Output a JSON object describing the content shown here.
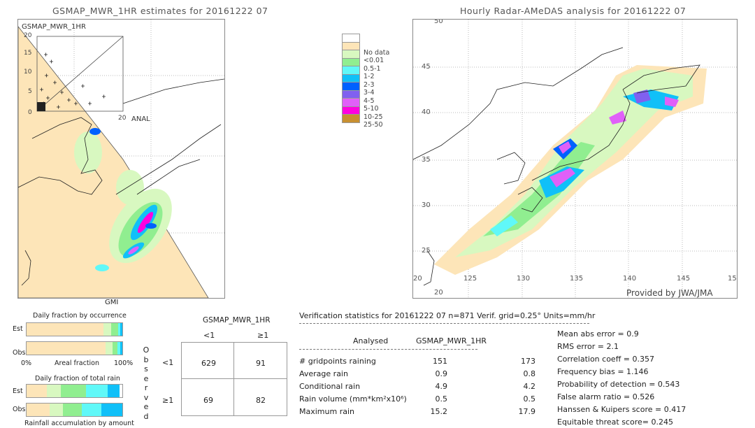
{
  "left_map": {
    "title": "GSMAP_MWR_1HR estimates for 20161222 07",
    "inset_label": "GSMAP_MWR_1HR",
    "inset_xlabel": "ANAL",
    "inset_ticks": [
      "0",
      "5",
      "10",
      "15",
      "20"
    ],
    "sensor_label": "GMI"
  },
  "right_map": {
    "title": "Hourly Radar-AMeDAS analysis for 20161222 07",
    "lon_ticks": [
      "125",
      "130",
      "135",
      "140",
      "145",
      "15"
    ],
    "lat_ticks": [
      "45",
      "40",
      "35",
      "30",
      "25",
      "20"
    ],
    "corner_labels": [
      "20",
      "20",
      "50"
    ],
    "credit": "Provided by JWA/JMA"
  },
  "legend": {
    "items": [
      {
        "label": "",
        "color": "#ffffff"
      },
      {
        "label": "No data",
        "color": "#fde5b8"
      },
      {
        "label": "<0.01",
        "color": "#d8f8c0"
      },
      {
        "label": "0.5-1",
        "color": "#90ee90"
      },
      {
        "label": "1-2",
        "color": "#60f8f8"
      },
      {
        "label": "2-3",
        "color": "#10c0f8"
      },
      {
        "label": "3-4",
        "color": "#0060ff"
      },
      {
        "label": "4-5",
        "color": "#8060f0"
      },
      {
        "label": "5-10",
        "color": "#e060f8"
      },
      {
        "label": "10-25",
        "color": "#ff00e0"
      },
      {
        "label": "25-50",
        "color": "#c89030"
      }
    ]
  },
  "occurrence": {
    "title": "Daily fraction by occurrence",
    "est_label": "Est",
    "obs_label": "Obs",
    "axis_left": "0%",
    "axis_mid": "Areal fraction",
    "axis_right": "100%",
    "est": [
      0.8,
      0.08,
      0.077,
      0.023,
      0.02
    ],
    "obs": [
      0.826,
      0.074,
      0.05,
      0.026,
      0.024
    ]
  },
  "total_rain": {
    "title": "Daily fraction of total rain",
    "est_label": "Est",
    "obs_label": "Obs",
    "footer": "Rainfall accumulation by amount",
    "est": [
      0.21,
      0.147,
      0.266,
      0.225,
      0.122
    ],
    "obs": [
      0.244,
      0.136,
      0.195,
      0.205,
      0.22
    ]
  },
  "bar_colors": [
    "#fde5b8",
    "#d8f8c0",
    "#90ee90",
    "#60f8f8",
    "#10c0f8"
  ],
  "contingency": {
    "header": "GSMAP_MWR_1HR",
    "col_labels": [
      "<1",
      "≥1"
    ],
    "row_labels": [
      "<1",
      "≥1"
    ],
    "side_label": [
      "O",
      "b",
      "s",
      "e",
      "r",
      "v",
      "e",
      "d"
    ],
    "cells": [
      [
        "629",
        "91"
      ],
      [
        "69",
        "82"
      ]
    ]
  },
  "stats": {
    "header": "Verification statistics for 20161222 07   n=871   Verif. grid=0.25°   Units=mm/hr",
    "col_analysed": "Analysed",
    "col_est": "GSMAP_MWR_1HR",
    "rows": [
      {
        "label": "# gridpoints raining",
        "a": "151",
        "b": "173"
      },
      {
        "label": "Average rain",
        "a": "0.9",
        "b": "0.8"
      },
      {
        "label": "Conditional rain",
        "a": "4.9",
        "b": "4.2"
      },
      {
        "label": "Rain volume (mm*km²x10⁶)",
        "a": "0.5",
        "b": "0.5"
      },
      {
        "label": "Maximum rain",
        "a": "15.2",
        "b": "17.9"
      }
    ],
    "scores": [
      "Mean abs error = 0.9",
      "RMS error = 2.1",
      "Correlation coeff = 0.357",
      "Frequency bias = 1.146",
      "Probability of detection = 0.543",
      "False alarm ratio = 0.526",
      "Hanssen & Kuipers score = 0.417",
      "Equitable threat score= 0.245"
    ]
  }
}
